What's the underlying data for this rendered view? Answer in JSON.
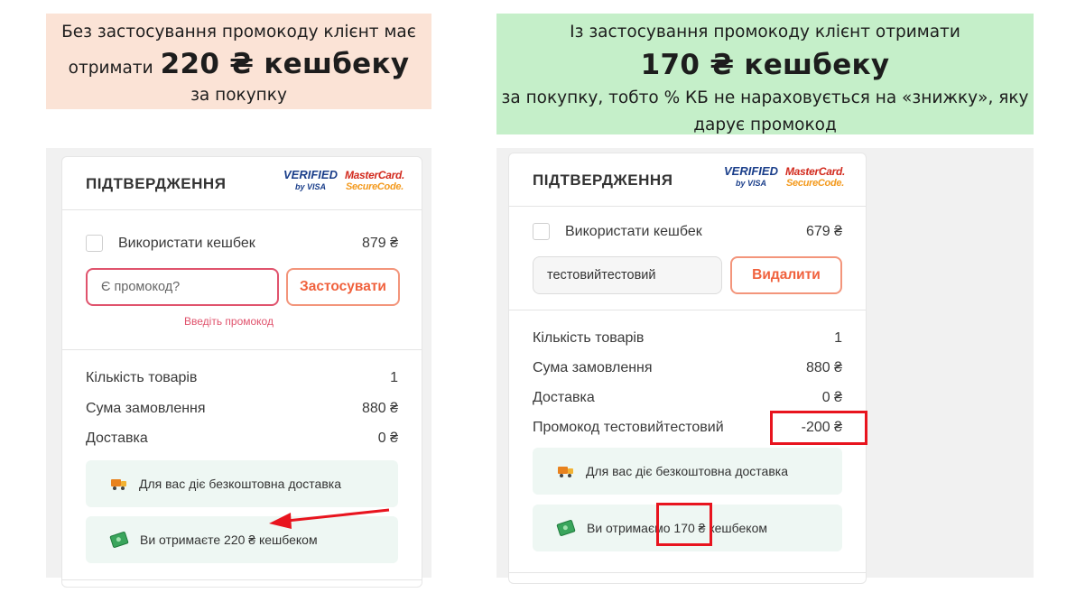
{
  "banners": {
    "left": {
      "line1": "Без застосування промокоду клієнт має",
      "pre_amount": "отримати",
      "amount": "220 ₴ кешбеку",
      "line3": "за покупку"
    },
    "right": {
      "line1": "Із застосування промокоду клієнт отримати",
      "amount": "170 ₴ кешбеку",
      "line3": "за покупку, тобто % КБ не нараховується на «знижку», яку",
      "line4": "дарує промокод"
    }
  },
  "logos": {
    "verified_line1": "VERIFIED",
    "verified_line2": "by VISA",
    "mc_line1": "MasterCard.",
    "mc_line2": "SecureCode."
  },
  "left_card": {
    "title": "ПІДТВЕРДЖЕННЯ",
    "use_cashback_label": "Використати кешбек",
    "cashback_amount": "879 ₴",
    "promo_placeholder": "Є промокод?",
    "apply_button": "Застосувати",
    "promo_error": "Введіть промокод",
    "summary": [
      {
        "label": "Кількість товарів",
        "value": "1"
      },
      {
        "label": "Сума замовлення",
        "value": "880 ₴"
      },
      {
        "label": "Доставка",
        "value": "0 ₴"
      }
    ],
    "free_delivery": "Для вас діє безкоштовна доставка",
    "cashback_notice": "Ви отримаєте 220 ₴ кешбеком"
  },
  "right_card": {
    "title": "ПІДТВЕРДЖЕННЯ",
    "use_cashback_label": "Використати кешбек",
    "cashback_amount": "679 ₴",
    "promo_value": "тестовийтестовий",
    "delete_button": "Видалити",
    "summary": [
      {
        "label": "Кількість товарів",
        "value": "1"
      },
      {
        "label": "Сума замовлення",
        "value": "880 ₴"
      },
      {
        "label": "Доставка",
        "value": "0 ₴"
      },
      {
        "label": "Промокод тестовийтестовий",
        "value": "-200 ₴"
      }
    ],
    "free_delivery": "Для вас діє безкоштовна доставка",
    "cashback_prefix": "Ви отримаємо",
    "cashback_amount_text": "170 ₴",
    "cashback_suffix": "кешбеком"
  },
  "colors": {
    "accent": "#f0613d",
    "error": "#e0536d",
    "highlight": "#e8141e",
    "banner_left_bg": "#fbe3d6",
    "banner_right_bg": "#c5efc9"
  }
}
